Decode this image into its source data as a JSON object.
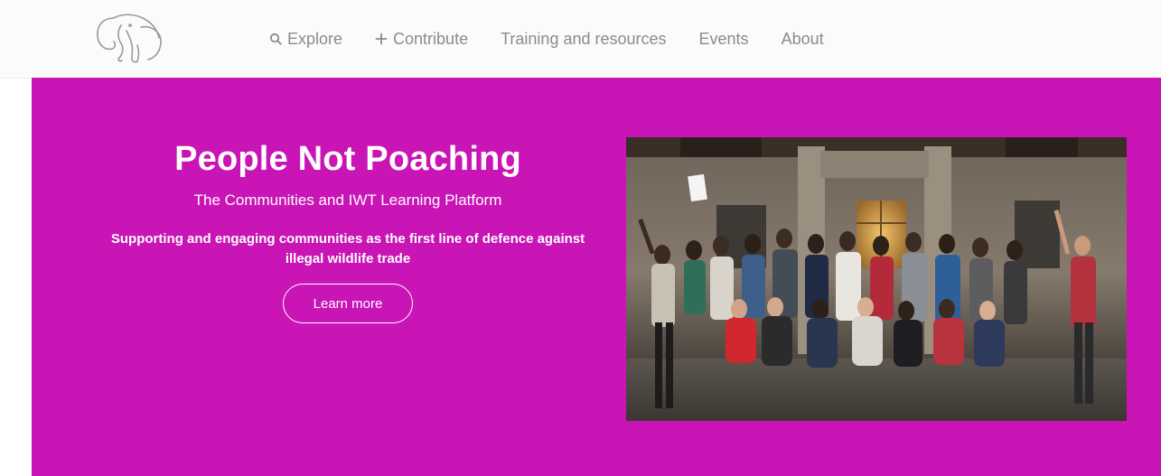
{
  "header": {
    "logo_icon": "elephant-icon",
    "nav": [
      {
        "label": "Explore",
        "icon": "search-icon"
      },
      {
        "label": "Contribute",
        "icon": "plus-icon"
      },
      {
        "label": "Training and resources",
        "icon": null
      },
      {
        "label": "Events",
        "icon": null
      },
      {
        "label": "About",
        "icon": null
      }
    ]
  },
  "hero": {
    "title": "People Not Poaching",
    "subtitle": "The Communities and IWT Learning Platform",
    "description": "Supporting and engaging communities as the first line of defence against illegal wildlife trade",
    "cta_label": "Learn more",
    "photo": "group-photo",
    "background_color": "#c914b6"
  },
  "colors": {
    "nav_text": "#8b8b8b",
    "header_bg": "#fbfbfb",
    "hero_text": "#ffffff"
  }
}
